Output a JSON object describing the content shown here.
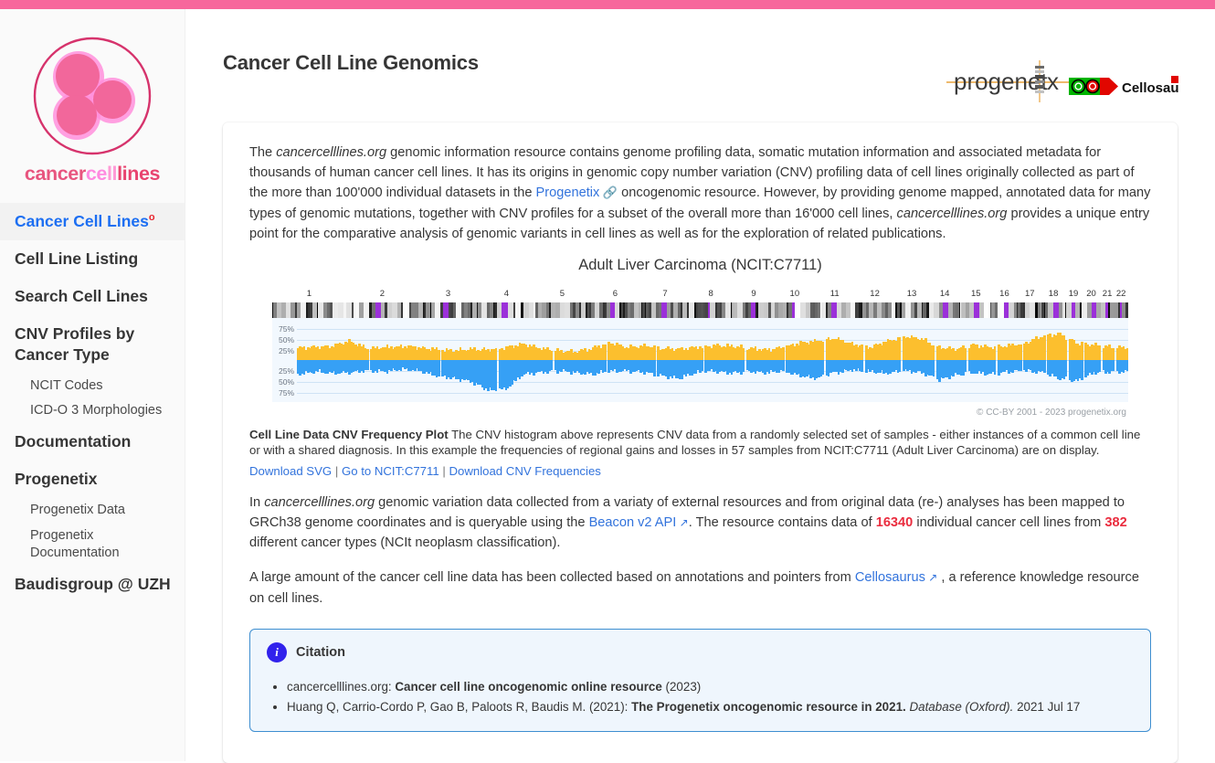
{
  "topbar": {
    "color": "#f7679c"
  },
  "sidebar": {
    "logo": {
      "word_parts": [
        "cancer",
        "ce",
        "ll",
        "lines"
      ],
      "alt": "cancercelllines logo"
    },
    "items": [
      {
        "label": "Cancer Cell Lines",
        "sup": "o",
        "active": true,
        "type": "main"
      },
      {
        "label": "Cell Line Listing",
        "active": false,
        "type": "main"
      },
      {
        "label": "Search Cell Lines",
        "active": false,
        "type": "main"
      },
      {
        "label": "CNV Profiles by Cancer Type",
        "active": false,
        "type": "main"
      },
      {
        "label": "NCIT Codes",
        "type": "sub"
      },
      {
        "label": "ICD-O 3 Morphologies",
        "type": "sub"
      },
      {
        "label": "Documentation",
        "type": "main"
      },
      {
        "label": "Progenetix",
        "type": "main"
      },
      {
        "label": "Progenetix Data",
        "type": "sub"
      },
      {
        "label": "Progenetix Documentation",
        "type": "sub"
      },
      {
        "label": "Baudisgroup @ UZH",
        "type": "main"
      }
    ]
  },
  "header": {
    "title": "Cancer Cell Line Genomics",
    "progenetix_logo_text": "progenetix",
    "cellosaurus_logo_text": "Cellosaurus"
  },
  "intro": {
    "p1_a": "The ",
    "p1_it1": "cancercelllines.org",
    "p1_b": " genomic information resource contains genome profiling data, somatic mutation information and associated metadata for thousands of human cancer cell lines. It has its origins in genomic copy number variation (CNV) profiling data of cell lines originally collected as part of the more than 100'000 individual datasets in the ",
    "p1_link": "Progenetix",
    "p1_c": " oncogenomic resource. However, by providing genome mapped, annotated data for many types of genomic mutations, together with CNV profiles for a subset of the overall more than 16'000 cell lines, ",
    "p1_it2": "cancercelllines.org",
    "p1_d": " provides a unique entry point for the comparative analysis of genomic variants in cell lines as well as for the exploration of related publications."
  },
  "chart_data": {
    "type": "area",
    "title": "Adult Liver Carcinoma (NCIT:C7711)",
    "xlabel": "",
    "ylabel": "",
    "ylim": [
      -100,
      100
    ],
    "gain_color": "#fcbf2e",
    "loss_color": "#36a0f5",
    "plot_bg": "#f2f8fe",
    "ytick_labels_top": [
      "75%",
      "50%",
      "25%"
    ],
    "ytick_labels_bottom": [
      "25%",
      "50%",
      "75%"
    ],
    "categories": [
      "1",
      "2",
      "3",
      "4",
      "5",
      "6",
      "7",
      "8",
      "9",
      "10",
      "11",
      "12",
      "13",
      "14",
      "15",
      "16",
      "17",
      "18",
      "19",
      "20",
      "21",
      "22"
    ],
    "chromosome_widths_pct": [
      8.3,
      8.1,
      6.7,
      6.4,
      6.1,
      5.8,
      5.4,
      4.9,
      4.7,
      4.5,
      4.5,
      4.5,
      3.8,
      3.6,
      3.4,
      3.0,
      2.7,
      2.6,
      1.9,
      2.1,
      1.5,
      1.6
    ],
    "series": [
      {
        "name": "gains",
        "values_pct": [
          28,
          31,
          33,
          45,
          27,
          30,
          32,
          30,
          25,
          22,
          26,
          24,
          30,
          38,
          28,
          22,
          20,
          28,
          42,
          30,
          34,
          28,
          26,
          30,
          34,
          33,
          28,
          24,
          30,
          40,
          46,
          52,
          38,
          30,
          44,
          56,
          50,
          30,
          26,
          36,
          30,
          34,
          40,
          58,
          62,
          40,
          36,
          30
        ]
      },
      {
        "name": "losses",
        "values_pct": [
          -34,
          -28,
          -32,
          -30,
          -25,
          -28,
          -22,
          -26,
          -38,
          -44,
          -52,
          -72,
          -70,
          -35,
          -30,
          -26,
          -30,
          -34,
          -28,
          -26,
          -30,
          -38,
          -44,
          -30,
          -26,
          -32,
          -28,
          -30,
          -26,
          -38,
          -44,
          -30,
          -24,
          -28,
          -32,
          -26,
          -30,
          -48,
          -36,
          -30,
          -34,
          -28,
          -26,
          -30,
          -44,
          -50,
          -30,
          -28
        ]
      }
    ],
    "copyright": "© CC-BY 2001 - 2023 progenetix.org"
  },
  "caption": {
    "bold_lead": "Cell Line Data CNV Frequency Plot",
    "text": " The CNV histogram above represents CNV data from a randomly selected set of samples - either instances of a common cell line or with a shared diagnosis. In this example the frequencies of regional gains and losses in 57 samples from NCIT:C7711 (Adult Liver Carcinoma) are on display.",
    "links": [
      "Download SVG",
      "Go to NCIT:C7711",
      "Download CNV Frequencies"
    ],
    "separator": " | "
  },
  "para2": {
    "a": "In ",
    "it": "cancercelllines.org",
    "b": " genomic variation data collected from a variaty of external resources and from original data (re-) analyses has been mapped to GRCh38 genome coordinates and is queryable using the ",
    "link": "Beacon v2 API",
    "c": ". The resource contains data of ",
    "num1": "16340",
    "d": " individual cancer cell lines from ",
    "num2": "382",
    "e": " different cancer types (NCIt neoplasm classification)."
  },
  "para3": {
    "a": "A large amount of the cancer cell line data has been collected based on annotations and pointers from ",
    "link": "Cellosaurus",
    "b": " , a reference knowledge resource on cell lines."
  },
  "citation": {
    "title": "Citation",
    "icon": "info-icon",
    "items": [
      {
        "pre": "cancercelllines.org: ",
        "bold": "Cancer cell line oncogenomic online resource",
        "post": " (2023)",
        "italic": ""
      },
      {
        "pre": "Huang Q, Carrio-Cordo P, Gao B, Paloots R, Baudis M. (2021): ",
        "bold": "The Progenetix oncogenomic resource in 2021.",
        "italic": " Database (Oxford).",
        "post": " 2021 Jul 17"
      }
    ]
  }
}
